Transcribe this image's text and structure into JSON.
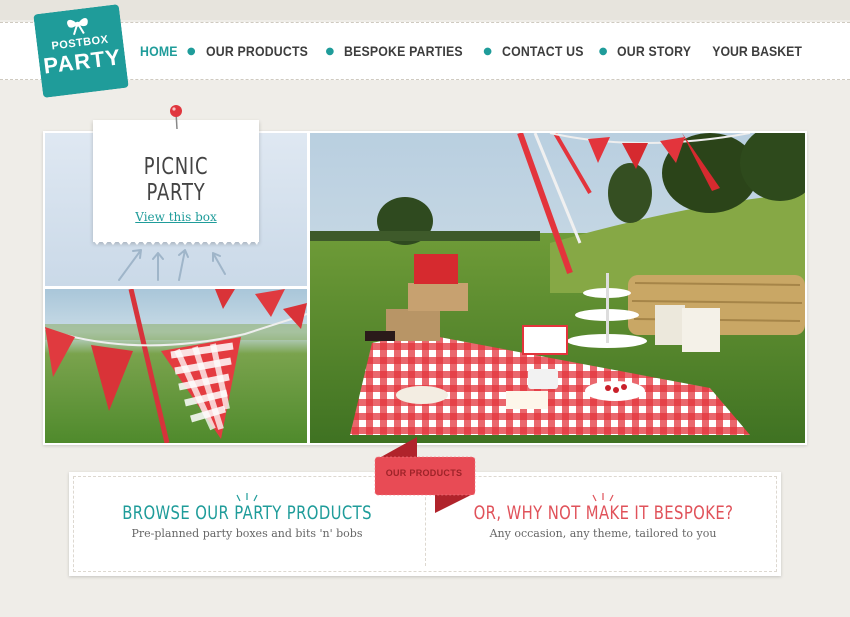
{
  "logo": {
    "line1": "POSTBOX",
    "line2": "PARTY"
  },
  "nav": {
    "items": [
      "HOME",
      "OUR PRODUCTS",
      "BESPOKE PARTIES",
      "CONTACT US",
      "OUR STORY"
    ],
    "active": "HOME",
    "basket": "YOUR BASKET"
  },
  "feature": {
    "title": "PICNIC PARTY",
    "link": "View this box"
  },
  "ribbon": {
    "label": "OUR PRODUCTS"
  },
  "promos": {
    "browse": {
      "title": "BROWSE OUR PARTY PRODUCTS",
      "subtitle": "Pre-planned party boxes and bits 'n' bobs"
    },
    "bespoke": {
      "title": "OR, WHY NOT MAKE IT BESPOKE?",
      "subtitle": "Any occasion, any theme, tailored to you"
    }
  },
  "colors": {
    "teal": "#1f9c9a",
    "red": "#e0525a",
    "ribbon": "#e84b55",
    "text": "#3d3d3d",
    "background": "#efede8"
  }
}
